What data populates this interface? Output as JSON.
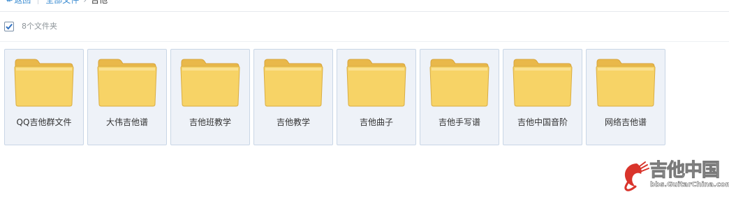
{
  "breadcrumb": {
    "back_label": "返回",
    "root_label": "全部文件",
    "current_label": "吉他"
  },
  "selection": {
    "checked": true,
    "count_label": "8个文件夹"
  },
  "folders": [
    {
      "name": "QQ吉他群文件"
    },
    {
      "name": "大伟吉他谱"
    },
    {
      "name": "吉他班教学"
    },
    {
      "name": "吉他教学"
    },
    {
      "name": "吉他曲子"
    },
    {
      "name": "吉他手写谱"
    },
    {
      "name": "吉他中国音阶"
    },
    {
      "name": "网络吉他谱"
    }
  ],
  "watermark": {
    "title": "吉他中国",
    "url": "bbs.GuitarChina.com"
  },
  "colors": {
    "link": "#3b8cd1",
    "tile_bg": "#eef2f8",
    "tile_border": "#c9d6e6",
    "folder_yellow": "#f7d366"
  }
}
